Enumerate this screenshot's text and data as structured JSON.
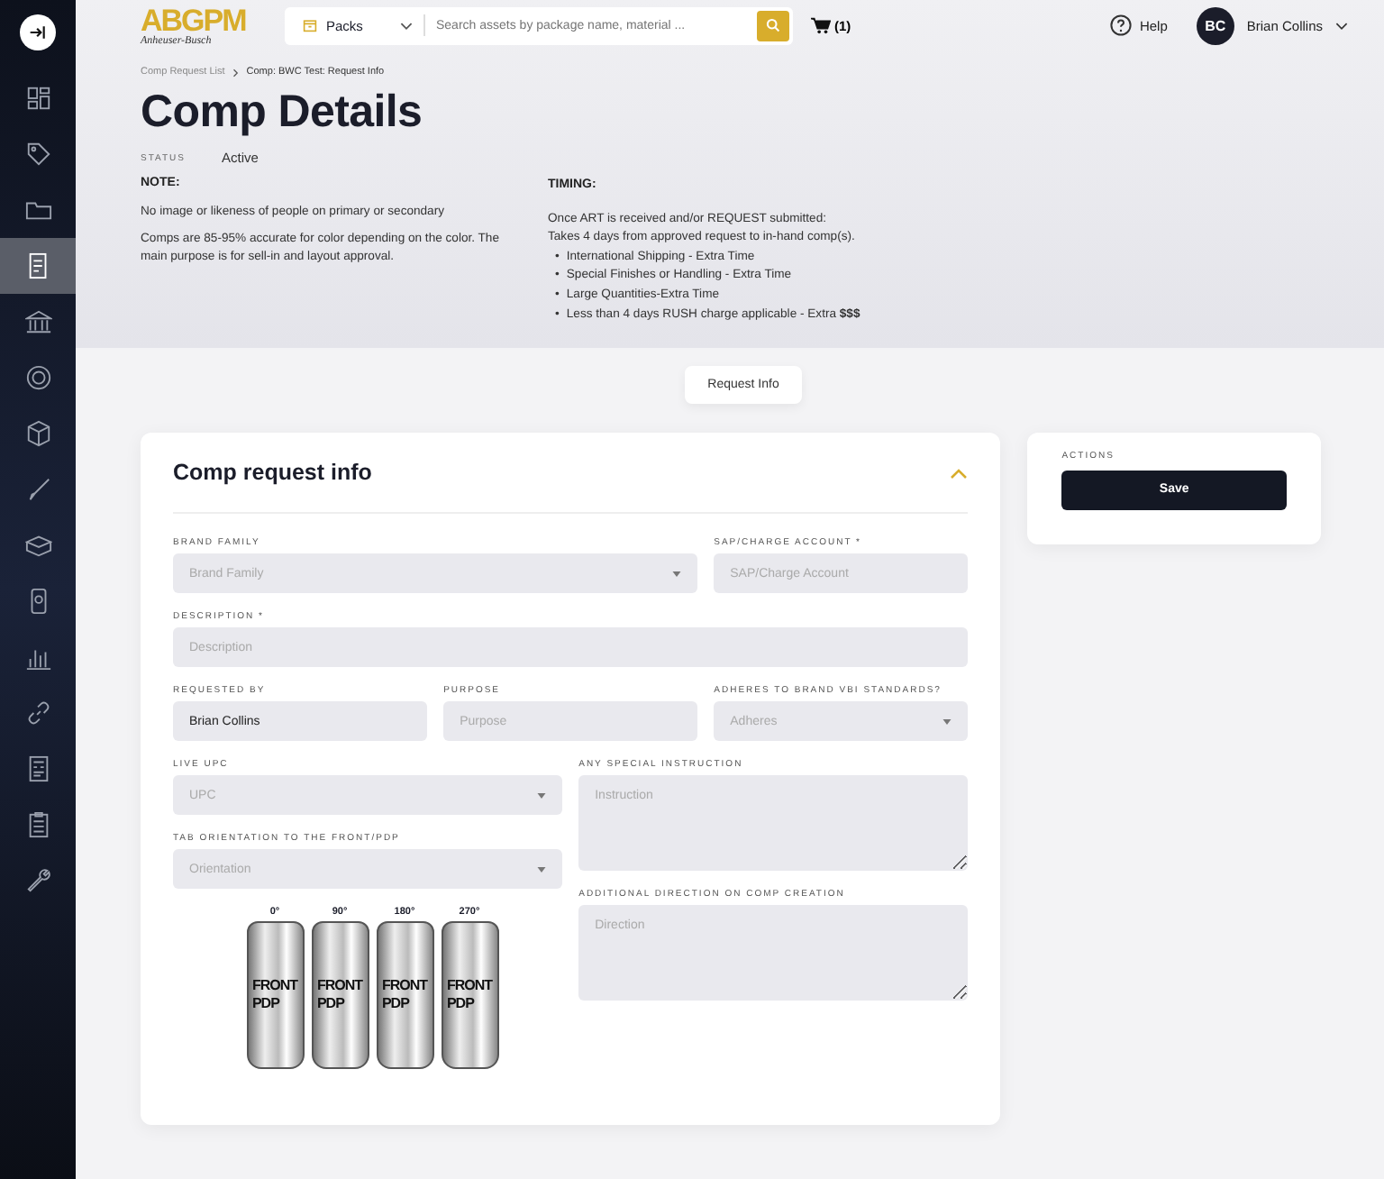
{
  "sidebar": {
    "items": [
      {
        "selected": false
      },
      {
        "selected": false
      },
      {
        "selected": false
      },
      {
        "selected": true
      },
      {
        "selected": false
      },
      {
        "selected": false
      },
      {
        "selected": false
      },
      {
        "selected": false
      },
      {
        "selected": false
      },
      {
        "selected": false
      },
      {
        "selected": false
      },
      {
        "selected": false
      },
      {
        "selected": false
      },
      {
        "selected": false
      },
      {
        "selected": false
      }
    ]
  },
  "topbar": {
    "logo": {
      "mark": "ABGPM",
      "tagline": "Anheuser-Busch"
    },
    "search": {
      "category": "Packs",
      "placeholder": "Search assets by package name, material ..."
    },
    "cart_count": "(1)",
    "help": "Help",
    "user": {
      "initials": "BC",
      "name": "Brian Collins"
    }
  },
  "breadcrumb": [
    {
      "label": "Comp Request List"
    },
    {
      "label": "Comp: BWC Test: Request Info"
    }
  ],
  "title": "Comp Details",
  "status": {
    "label": "STATUS",
    "value": "Active"
  },
  "note": {
    "heading": "NOTE:",
    "paragraphs": [
      "No image or likeness of people on primary or secondary",
      "Comps are 85-95% accurate for color depending on the color. The main purpose is for sell-in and layout approval."
    ]
  },
  "timing": {
    "heading": "TIMING:",
    "lines": [
      "Once ART is received and/or REQUEST submitted:",
      "Takes 4 days from approved request to in-hand comp(s)."
    ],
    "bullets": [
      {
        "marker": "•",
        "text": "International Shipping - Extra Time"
      },
      {
        "marker": "•",
        "text": "Special Finishes or Handling - Extra Time"
      },
      {
        "marker": "•",
        "text": "Large Quantities-Extra Time"
      },
      {
        "marker": "•",
        "text": "Less than 4 days RUSH charge applicable - Extra **$$$**"
      }
    ]
  },
  "tabs": [
    {
      "label": "Request Info",
      "selected": true
    }
  ],
  "form": {
    "title": "Comp request info",
    "expanded": true,
    "top_rows": [
      [
        {
          "label": "BRAND FAMILY",
          "kind": "select",
          "placeholder": "Brand Family"
        },
        {
          "label": "SAP/CHARGE ACCOUNT *",
          "kind": "input",
          "placeholder": "SAP/Charge Account"
        }
      ],
      [
        {
          "label": "DESCRIPTION *",
          "kind": "input",
          "placeholder": "Description"
        }
      ],
      [
        {
          "label": "REQUESTED BY",
          "kind": "input",
          "value": "Brian Collins"
        },
        {
          "label": "PURPOSE",
          "kind": "input",
          "placeholder": "Purpose"
        },
        {
          "label": "ADHERES TO BRAND VBI STANDARDS?",
          "kind": "select",
          "placeholder": "Adheres"
        }
      ]
    ],
    "left_column": [
      {
        "label": "LIVE UPC",
        "kind": "select",
        "placeholder": "UPC"
      },
      {
        "label": "TAB ORIENTATION TO THE FRONT/PDP",
        "kind": "select",
        "placeholder": "Orientation"
      }
    ],
    "orientation_diagram": {
      "cans": [
        {
          "angle": "0°",
          "lines": [
            "FRONT",
            "PDP"
          ]
        },
        {
          "angle": "90°",
          "lines": [
            "FRONT",
            "PDP"
          ]
        },
        {
          "angle": "180°",
          "lines": [
            "FRONT",
            "PDP"
          ]
        },
        {
          "angle": "270°",
          "lines": [
            "FRONT",
            "PDP"
          ]
        }
      ]
    },
    "right_column": [
      {
        "label": "ANY SPECIAL INSTRUCTION",
        "kind": "textarea",
        "placeholder": "Instruction"
      },
      {
        "label": "ADDITIONAL DIRECTION ON COMP CREATION",
        "kind": "textarea",
        "placeholder": "Direction"
      }
    ]
  },
  "actions": {
    "heading": "ACTIONS",
    "buttons": [
      {
        "label": "Save"
      }
    ]
  }
}
